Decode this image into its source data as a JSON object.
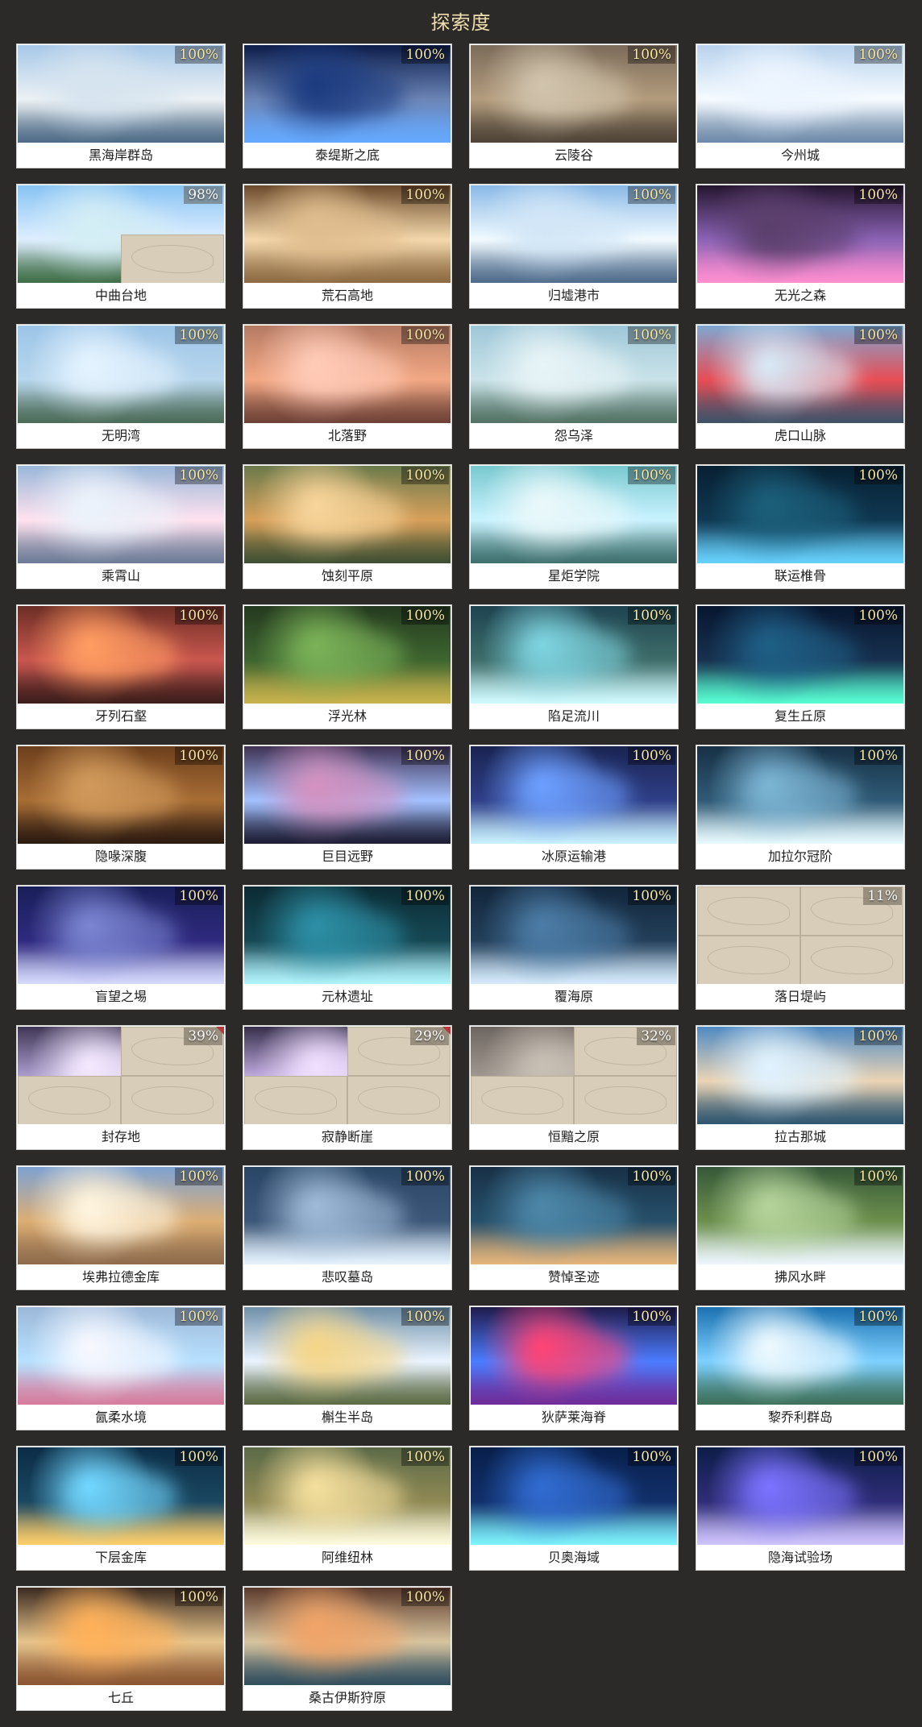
{
  "page": {
    "title": "探索度"
  },
  "cards": [
    {
      "name": "黑海岸群岛",
      "percent": "100%",
      "palette": [
        "#a7c8e8",
        "#d6e4ef",
        "#4d6a86",
        "#ecf1f4"
      ],
      "state": "full"
    },
    {
      "name": "泰缇斯之底",
      "percent": "100%",
      "palette": [
        "#0d1d4a",
        "#1c3b80",
        "#65a9ff",
        "#6b85b6"
      ],
      "state": "full"
    },
    {
      "name": "云陵谷",
      "percent": "100%",
      "palette": [
        "#7b6b5a",
        "#d1c4ad",
        "#4e4337",
        "#b39c7d"
      ],
      "state": "full"
    },
    {
      "name": "今州城",
      "percent": "100%",
      "palette": [
        "#b8d2ec",
        "#edf5ff",
        "#6d89a8",
        "#f6fbff"
      ],
      "state": "full"
    },
    {
      "name": "中曲台地",
      "percent": "98%",
      "palette": [
        "#88c3f4",
        "#d4eef5",
        "#3e6d46",
        "#dfeeff"
      ],
      "state": "partial-3"
    },
    {
      "name": "荒石高地",
      "percent": "100%",
      "palette": [
        "#6b4a2b",
        "#e0bd8e",
        "#8d6a42",
        "#f4d8ac"
      ],
      "state": "full"
    },
    {
      "name": "归墟港市",
      "percent": "100%",
      "palette": [
        "#89b8e6",
        "#d2e6f7",
        "#4e6a8a",
        "#f2fbff"
      ],
      "state": "full"
    },
    {
      "name": "无光之森",
      "percent": "100%",
      "palette": [
        "#24152e",
        "#5b3f6b",
        "#ff8fd0",
        "#8b63b5"
      ],
      "state": "full"
    },
    {
      "name": "无明湾",
      "percent": "100%",
      "palette": [
        "#9dc5e8",
        "#e4f3ff",
        "#4b6b58",
        "#b8d6ec"
      ],
      "state": "full"
    },
    {
      "name": "北落野",
      "percent": "100%",
      "palette": [
        "#b57a63",
        "#ffcbb8",
        "#6e4136",
        "#f2a884"
      ],
      "state": "full"
    },
    {
      "name": "怨乌泽",
      "percent": "100%",
      "palette": [
        "#9fc7d8",
        "#e8f4f7",
        "#527264",
        "#c9e2e8"
      ],
      "state": "full"
    },
    {
      "name": "虎口山脉",
      "percent": "100%",
      "palette": [
        "#7ea7d1",
        "#d8e8f5",
        "#3f5268",
        "#e84d55"
      ],
      "state": "full"
    },
    {
      "name": "乘霄山",
      "percent": "100%",
      "palette": [
        "#9ab7d8",
        "#ebf3fb",
        "#6c7b96",
        "#ffe2ef"
      ],
      "state": "full"
    },
    {
      "name": "蚀刻平原",
      "percent": "100%",
      "palette": [
        "#6b7a4b",
        "#f7d59b",
        "#3e4f32",
        "#d7a05b"
      ],
      "state": "full"
    },
    {
      "name": "星炬学院",
      "percent": "100%",
      "palette": [
        "#79c8cf",
        "#eaf8fa",
        "#3d6f6d",
        "#c9f3ff"
      ],
      "state": "full"
    },
    {
      "name": "联运椎骨",
      "percent": "100%",
      "palette": [
        "#082032",
        "#1c5f7a",
        "#68d3ff",
        "#0f3852"
      ],
      "state": "full"
    },
    {
      "name": "牙列石壑",
      "percent": "100%",
      "palette": [
        "#6b2e25",
        "#ff9c62",
        "#3c1d1b",
        "#c9574f"
      ],
      "state": "full"
    },
    {
      "name": "浮光林",
      "percent": "100%",
      "palette": [
        "#24391f",
        "#7bb258",
        "#c9b34d",
        "#3e6530"
      ],
      "state": "full"
    },
    {
      "name": "陷足流川",
      "percent": "100%",
      "palette": [
        "#1e4350",
        "#7ed4e0",
        "#d1fbff",
        "#3e6d6a"
      ],
      "state": "full"
    },
    {
      "name": "复生丘原",
      "percent": "100%",
      "palette": [
        "#08162f",
        "#1f5f86",
        "#58ffd3",
        "#17314f"
      ],
      "state": "full"
    },
    {
      "name": "隐喙深腹",
      "percent": "100%",
      "palette": [
        "#6c3f1d",
        "#d19a5c",
        "#2b1a10",
        "#a86d35"
      ],
      "state": "full"
    },
    {
      "name": "巨目远野",
      "percent": "100%",
      "palette": [
        "#3f3254",
        "#d392c0",
        "#1c1b33",
        "#a3c1ff"
      ],
      "state": "full"
    },
    {
      "name": "冰原运输港",
      "percent": "100%",
      "palette": [
        "#1a2451",
        "#6d9fff",
        "#caf2ff",
        "#2f3f88"
      ],
      "state": "full"
    },
    {
      "name": "加拉尔冠阶",
      "percent": "100%",
      "palette": [
        "#173045",
        "#7cb5d4",
        "#e9fbff",
        "#2f5a76"
      ],
      "state": "full"
    },
    {
      "name": "盲望之埸",
      "percent": "100%",
      "palette": [
        "#191f59",
        "#7a84d1",
        "#d8dcff",
        "#2f2a7e"
      ],
      "state": "full"
    },
    {
      "name": "元林遗址",
      "percent": "100%",
      "palette": [
        "#0c2b34",
        "#2d8fa5",
        "#b4f6ff",
        "#164854"
      ],
      "state": "full"
    },
    {
      "name": "覆海原",
      "percent": "100%",
      "palette": [
        "#12263b",
        "#4c7ca6",
        "#d8edff",
        "#233f5a"
      ],
      "state": "full"
    },
    {
      "name": "落日堤屿",
      "percent": "11%",
      "palette": [
        "#d7cdb9",
        "#ccbf9f",
        "#b9ad95",
        "#e3dac9"
      ],
      "state": "empty"
    },
    {
      "name": "封存地",
      "percent": "39%",
      "palette": [
        "#403857",
        "#f4e9ff",
        "#7e6c8f",
        "#b4a6d8"
      ],
      "state": "partial-1",
      "flag": true
    },
    {
      "name": "寂静断崖",
      "percent": "29%",
      "palette": [
        "#362f4c",
        "#f1dfff",
        "#8b6b92",
        "#cbb4ea"
      ],
      "state": "partial-1",
      "flag": true
    },
    {
      "name": "恒黯之原",
      "percent": "32%",
      "palette": [
        "#6e6660",
        "#c8c0b5",
        "#4c4540",
        "#a39b93"
      ],
      "state": "partial-1"
    },
    {
      "name": "拉古那城",
      "percent": "100%",
      "palette": [
        "#4f8ac3",
        "#dff2ff",
        "#2d556f",
        "#ebd4b4"
      ],
      "state": "full"
    },
    {
      "name": "埃弗拉德金库",
      "percent": "100%",
      "palette": [
        "#7ea2d3",
        "#fff5df",
        "#8e6b4c",
        "#dcae74"
      ],
      "state": "full"
    },
    {
      "name": "悲叹墓岛",
      "percent": "100%",
      "palette": [
        "#2a4665",
        "#9ebad8",
        "#e7f4ff",
        "#3d5778"
      ],
      "state": "full"
    },
    {
      "name": "赞悼圣迹",
      "percent": "100%",
      "palette": [
        "#183046",
        "#4d87a8",
        "#e6b57b",
        "#27506b"
      ],
      "state": "full"
    },
    {
      "name": "拂风水畔",
      "percent": "100%",
      "palette": [
        "#365839",
        "#b3d39a",
        "#eef7ff",
        "#6c8f4d"
      ],
      "state": "full"
    },
    {
      "name": "氤柔水境",
      "percent": "100%",
      "palette": [
        "#9db8d8",
        "#f7f8ff",
        "#d67b9b",
        "#b7e1ff"
      ],
      "state": "full"
    },
    {
      "name": "槲生半岛",
      "percent": "100%",
      "palette": [
        "#6e8fa7",
        "#f5d689",
        "#5b6a43",
        "#e9f3ff"
      ],
      "state": "full"
    },
    {
      "name": "狄萨莱海脊",
      "percent": "100%",
      "palette": [
        "#201b4b",
        "#ff4474",
        "#6f2c98",
        "#4b7cff"
      ],
      "state": "full"
    },
    {
      "name": "黎乔利群岛",
      "percent": "100%",
      "palette": [
        "#1b71b0",
        "#eef9ff",
        "#3c6f59",
        "#7dd0ff"
      ],
      "state": "full"
    },
    {
      "name": "下层金库",
      "percent": "100%",
      "palette": [
        "#0c2c46",
        "#72d7ff",
        "#ffcf6a",
        "#1a4761"
      ],
      "state": "full"
    },
    {
      "name": "阿维纽林",
      "percent": "100%",
      "palette": [
        "#5b6a47",
        "#f4df9d",
        "#fffce0",
        "#8f8955"
      ],
      "state": "full"
    },
    {
      "name": "贝奥海域",
      "percent": "100%",
      "palette": [
        "#081f4a",
        "#316cd1",
        "#7ff5ff",
        "#12306b"
      ],
      "state": "full"
    },
    {
      "name": "隐海试验场",
      "percent": "100%",
      "palette": [
        "#0d1d48",
        "#7b73ff",
        "#d1c6ff",
        "#2f2d77"
      ],
      "state": "full"
    },
    {
      "name": "七丘",
      "percent": "100%",
      "palette": [
        "#3b2a20",
        "#ffb15a",
        "#8a5430",
        "#e6c48c"
      ],
      "state": "full"
    },
    {
      "name": "桑古伊斯狩原",
      "percent": "100%",
      "palette": [
        "#5c3a2b",
        "#f1a468",
        "#2f4d5e",
        "#d7c49f"
      ],
      "state": "full"
    }
  ]
}
